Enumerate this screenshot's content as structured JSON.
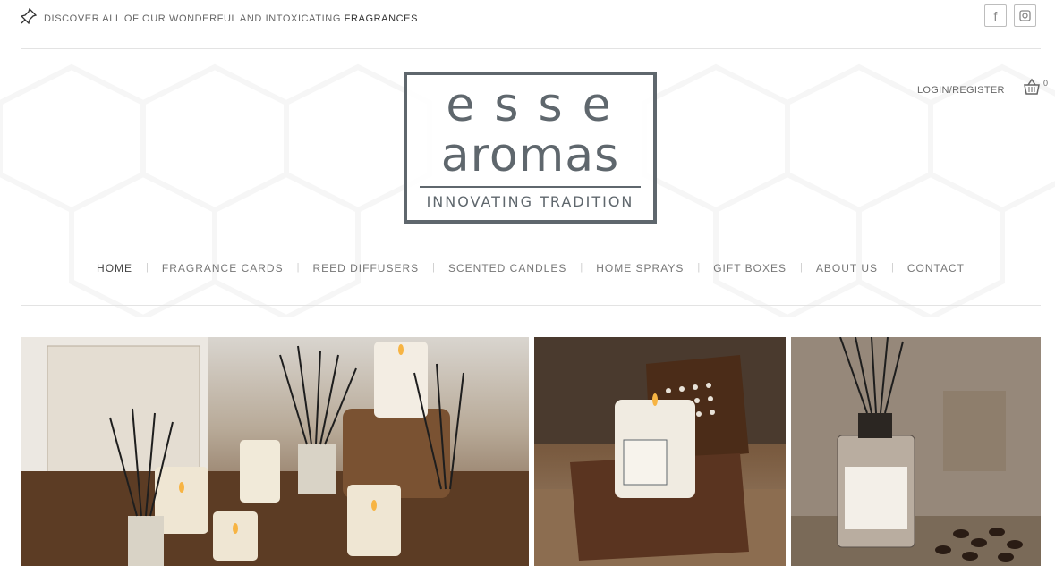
{
  "topbar": {
    "tagline_prefix": "DISCOVER ALL OF OUR WONDERFUL AND INTOXICATING",
    "tagline_highlight": "FRAGRANCES",
    "social": [
      {
        "name": "facebook-icon",
        "glyph": "f"
      },
      {
        "name": "instagram-icon",
        "glyph": "◎"
      }
    ]
  },
  "logo": {
    "line1": "esse",
    "line2": "aromas",
    "line3": "INNOVATING TRADITION",
    "color": "#5f676d"
  },
  "account": {
    "login_label": "LOGIN/REGISTER",
    "cart_count": "0"
  },
  "nav": {
    "items": [
      {
        "label": "HOME",
        "active": true
      },
      {
        "label": "FRAGRANCE CARDS"
      },
      {
        "label": "REED DIFFUSERS"
      },
      {
        "label": "SCENTED CANDLES"
      },
      {
        "label": "HOME SPRAYS"
      },
      {
        "label": "GIFT BOXES"
      },
      {
        "label": "ABOUT US"
      },
      {
        "label": "CONTACT"
      }
    ],
    "separator": "|"
  },
  "gallery": {
    "photos": [
      {
        "name": "hero-photo-collection",
        "subject": "candles, reed diffusers and gift bag"
      },
      {
        "name": "hero-photo-candle-box",
        "subject": "candle in wooden box"
      },
      {
        "name": "hero-photo-diffuser",
        "subject": "reed diffuser with coffee beans"
      }
    ]
  }
}
